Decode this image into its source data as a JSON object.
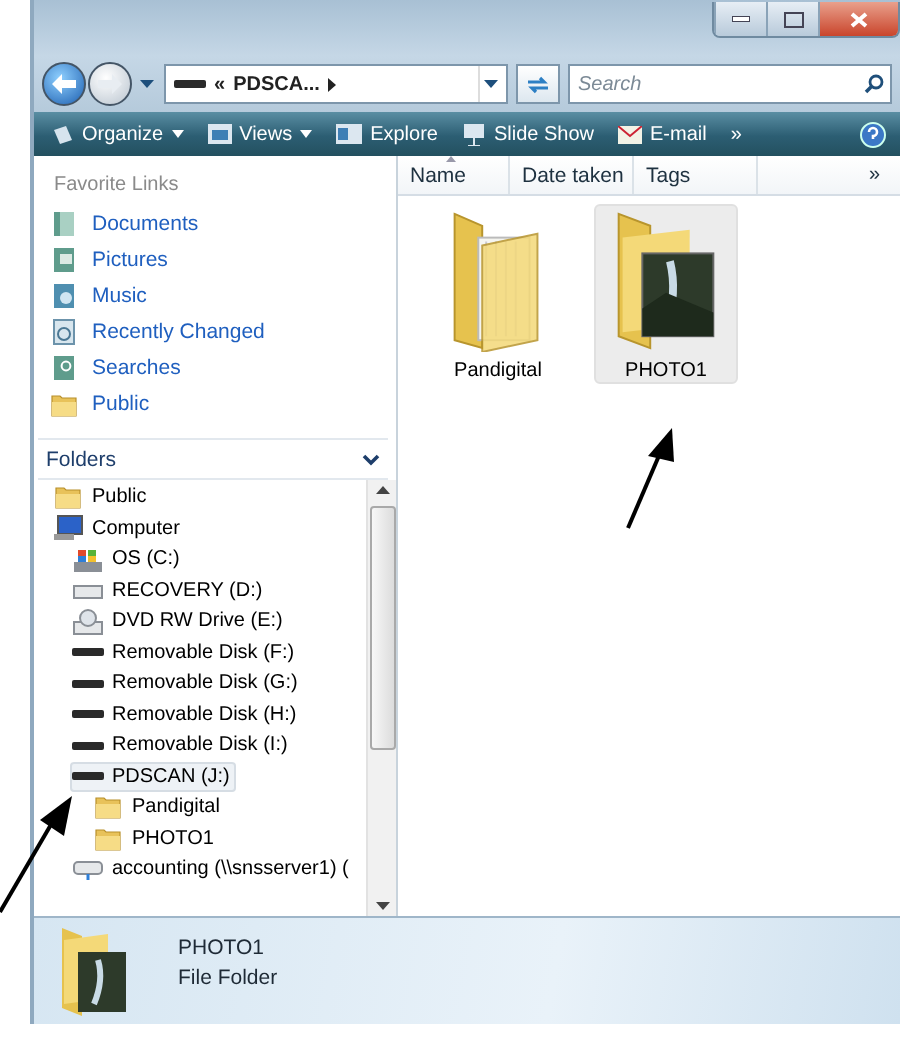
{
  "window": {
    "caption_buttons": [
      {
        "kind": "minimize"
      },
      {
        "kind": "maximize"
      },
      {
        "kind": "close"
      }
    ]
  },
  "address_bar": {
    "overflow": "«",
    "crumb": "PDSCA...",
    "search": {
      "placeholder": "Search"
    }
  },
  "command_bar": {
    "items": [
      {
        "label": "Organize",
        "kind": "organize",
        "menu": true
      },
      {
        "label": "Views",
        "kind": "views",
        "menu": true
      },
      {
        "label": "Explore",
        "kind": "explore",
        "menu": false
      },
      {
        "label": "Slide Show",
        "kind": "slideshow",
        "menu": false
      },
      {
        "label": "E-mail",
        "kind": "email",
        "menu": false
      }
    ],
    "more": "»"
  },
  "navigation_pane": {
    "favorites": {
      "title": "Favorite Links",
      "items": [
        {
          "label": "Documents",
          "kind": "documents"
        },
        {
          "label": "Pictures",
          "kind": "pictures"
        },
        {
          "label": "Music",
          "kind": "music"
        },
        {
          "label": "Recently Changed",
          "kind": "recent"
        },
        {
          "label": "Searches",
          "kind": "searches"
        },
        {
          "label": "Public",
          "kind": "folder"
        }
      ]
    },
    "folders": {
      "title": "Folders",
      "tree": [
        {
          "label": "Public",
          "kind": "folder",
          "selected": false
        },
        {
          "label": "Computer",
          "kind": "computer",
          "selected": false,
          "children": [
            {
              "label": "OS (C:)",
              "kind": "system-drive",
              "selected": false
            },
            {
              "label": "RECOVERY (D:)",
              "kind": "hard-drive",
              "selected": false
            },
            {
              "label": "DVD RW Drive (E:)",
              "kind": "optical-drive",
              "selected": false
            },
            {
              "label": "Removable Disk (F:)",
              "kind": "removable",
              "selected": false
            },
            {
              "label": "Removable Disk (G:)",
              "kind": "removable",
              "selected": false
            },
            {
              "label": "Removable Disk (H:)",
              "kind": "removable",
              "selected": false
            },
            {
              "label": "Removable Disk (I:)",
              "kind": "removable",
              "selected": false
            },
            {
              "label": "PDSCAN (J:)",
              "kind": "removable",
              "selected": true,
              "children": [
                {
                  "label": "Pandigital",
                  "kind": "folder",
                  "selected": false
                },
                {
                  "label": "PHOTO1",
                  "kind": "folder",
                  "selected": false
                }
              ]
            },
            {
              "label": "accounting (\\\\snsserver1) (",
              "kind": "network",
              "selected": false
            }
          ]
        }
      ]
    }
  },
  "file_list": {
    "columns": [
      "Name",
      "Date taken",
      "Tags"
    ],
    "more": "»",
    "items": [
      {
        "name": "Pandigital",
        "kind": "documents-folder",
        "selected": false
      },
      {
        "name": "PHOTO1",
        "kind": "photo-folder",
        "selected": true
      }
    ]
  },
  "details_pane": {
    "name": "PHOTO1",
    "type": "File Folder"
  }
}
